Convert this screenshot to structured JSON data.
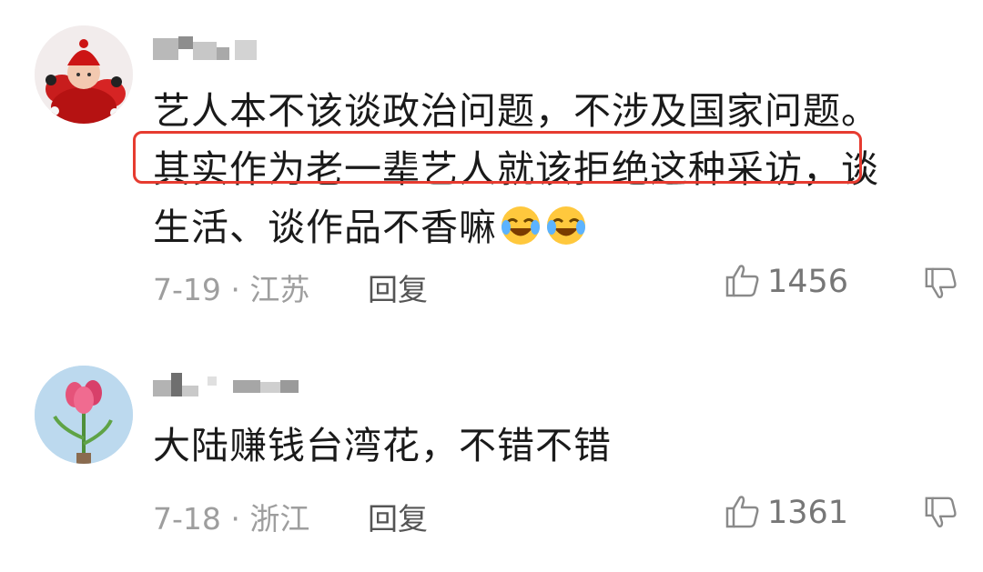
{
  "comments": [
    {
      "avatar_icon": "baby-in-red-avatar",
      "text_line1": "艺人本不该谈政治问题，不涉及国家问题。",
      "text_line2": "其实作为老一辈艺人就该拒绝这种采访，谈",
      "text_line3": "生活、谈作品不香嘛",
      "emoji_icons": [
        "laughing-crying-emoji",
        "laughing-crying-emoji"
      ],
      "meta": "7-19 · 江苏",
      "reply_label": "回复",
      "likes": "1456",
      "highlight_color": "#e63b30"
    },
    {
      "avatar_icon": "pink-flower-avatar",
      "text_line1": "大陆赚钱台湾花，不错不错",
      "meta": "7-18 · 浙江",
      "reply_label": "回复",
      "likes": "1361"
    }
  ],
  "colors": {
    "meta": "#9e9e9e",
    "reply": "#555555",
    "text": "#1a1a1a"
  }
}
